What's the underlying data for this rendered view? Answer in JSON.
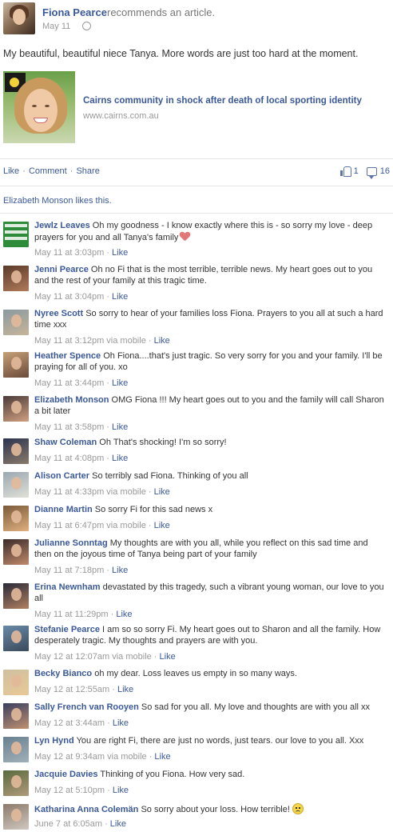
{
  "post": {
    "author": "Fiona Pearce",
    "verb": "recommends an article.",
    "date": "May 11",
    "status": "My beautiful, beautiful niece Tanya. More words are just too hard at the moment."
  },
  "shared_article": {
    "title": "Cairns community in shock after death of local sporting identity",
    "domain": "www.cairns.com.au"
  },
  "actions": {
    "like": "Like",
    "comment": "Comment",
    "share": "Share",
    "separator": "·",
    "like_count": "1",
    "comment_count": "16"
  },
  "likes_line": "Elizabeth Monson likes this.",
  "comments": [
    {
      "name": "Jewlz Leaves",
      "text": "Oh my goodness - I know exactly where this is - so sorry my love - deep prayers for you and all Tanya's family",
      "time": "May 11 at 3:03pm",
      "via": "",
      "like": "Like",
      "emoji": "heart"
    },
    {
      "name": "Jenni Pearce",
      "text": "Oh no Fi that is the most terrible, terrible news. My heart goes out to you and the rest of your family at this tragic time.",
      "time": "May 11 at 3:04pm",
      "via": "",
      "like": "Like",
      "emoji": ""
    },
    {
      "name": "Nyree Scott",
      "text": "So sorry to hear of your families loss Fiona. Prayers to you all at such a hard time xxx",
      "time": "May 11 at 3:12pm",
      "via": "via mobile",
      "like": "Like",
      "emoji": ""
    },
    {
      "name": "Heather Spence",
      "text": "Oh Fiona....that's just tragic. So very sorry for you and your family. I'll be praying for all of you. xo",
      "time": "May 11 at 3:44pm",
      "via": "",
      "like": "Like",
      "emoji": ""
    },
    {
      "name": "Elizabeth Monson",
      "text": "OMG Fiona !!! My heart goes out to you and the family will call Sharon a bit later",
      "time": "May 11 at 3:58pm",
      "via": "",
      "like": "Like",
      "emoji": ""
    },
    {
      "name": "Shaw Coleman",
      "text": "Oh That's shocking! I'm so sorry!",
      "time": "May 11 at 4:08pm",
      "via": "",
      "like": "Like",
      "emoji": ""
    },
    {
      "name": "Alison Carter",
      "text": "So terribly sad Fiona. Thinking of you all",
      "time": "May 11 at 4:33pm",
      "via": "via mobile",
      "like": "Like",
      "emoji": ""
    },
    {
      "name": "Dianne Martin",
      "text": "So sorry Fi for this sad news x",
      "time": "May 11 at 6:47pm",
      "via": "via mobile",
      "like": "Like",
      "emoji": ""
    },
    {
      "name": "Julianne Sonntag",
      "text": "My thoughts are with you all, while you reflect on this sad time and then on the joyous time of Tanya being part of your family",
      "time": "May 11 at 7:18pm",
      "via": "",
      "like": "Like",
      "emoji": ""
    },
    {
      "name": "Erina Newnham",
      "text": "devastated by this tragedy, such a vibrant young woman, our love to you all",
      "time": "May 11 at 11:29pm",
      "via": "",
      "like": "Like",
      "emoji": ""
    },
    {
      "name": "Stefanie Pearce",
      "text": "I am so so sorry Fi. My heart goes out to Sharon and all the family. How desperately tragic. My thoughts and prayers are with you.",
      "time": "May 12 at 12:07am",
      "via": "via mobile",
      "like": "Like",
      "emoji": ""
    },
    {
      "name": "Becky Bianco",
      "text": "oh my dear. Loss leaves us empty in so many ways.",
      "time": "May 12 at 12:55am",
      "via": "",
      "like": "Like",
      "emoji": ""
    },
    {
      "name": "Sally French van Rooyen",
      "text": "So sad for you all. My love and thoughts are with you all xx",
      "time": "May 12 at 3:44am",
      "via": "",
      "like": "Like",
      "emoji": ""
    },
    {
      "name": "Lyn Hynd",
      "text": "You are right Fi, there are just no words, just tears. our love to you all. Xxx",
      "time": "May 12 at 9:34am",
      "via": "via mobile",
      "like": "Like",
      "emoji": ""
    },
    {
      "name": "Jacquie Davies",
      "text": "Thinking of you Fiona. How very sad.",
      "time": "May 12 at 5:10pm",
      "via": "",
      "like": "Like",
      "emoji": ""
    },
    {
      "name": "Katharina Anna Colemän",
      "text": "So sorry about your loss. How terrible!",
      "time": "June 7 at 6:05am",
      "via": "",
      "like": "Like",
      "emoji": "frown"
    }
  ],
  "colors": {
    "link": "#3b5998",
    "muted": "#999999",
    "text": "#333333"
  }
}
